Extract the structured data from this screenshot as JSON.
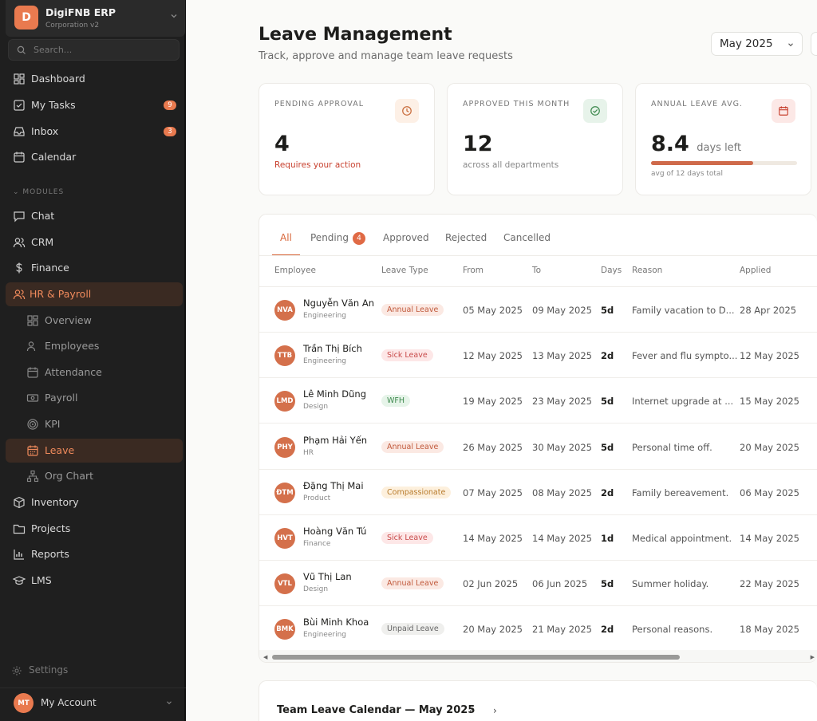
{
  "brand": {
    "initial": "D",
    "name": "DigiFNB ERP",
    "sub": "Corporation v2"
  },
  "search": {
    "placeholder": "Search..."
  },
  "nav_top": [
    {
      "label": "Dashboard",
      "icon": "dashboard-icon"
    },
    {
      "label": "My Tasks",
      "icon": "tasks-icon",
      "badge": "9"
    },
    {
      "label": "Inbox",
      "icon": "inbox-icon",
      "badge": "3"
    },
    {
      "label": "Calendar",
      "icon": "calendar-icon"
    }
  ],
  "modules_label": "MODULES",
  "nav_modules": [
    {
      "label": "Chat"
    },
    {
      "label": "CRM"
    },
    {
      "label": "Finance"
    },
    {
      "label": "HR & Payroll"
    }
  ],
  "nav_hr_sub": [
    {
      "label": "Overview"
    },
    {
      "label": "Employees"
    },
    {
      "label": "Attendance"
    },
    {
      "label": "Payroll"
    },
    {
      "label": "KPI"
    },
    {
      "label": "Leave"
    },
    {
      "label": "Org Chart"
    }
  ],
  "nav_bottom": [
    {
      "label": "Inventory"
    },
    {
      "label": "Projects"
    },
    {
      "label": "Reports"
    },
    {
      "label": "LMS"
    }
  ],
  "settings_label": "Settings",
  "account": {
    "initials": "MT",
    "label": "My Account"
  },
  "header": {
    "title": "Leave Management",
    "subtitle": "Track, approve and manage team leave requests",
    "month": "May 2025"
  },
  "cards": [
    {
      "label": "PENDING APPROVAL",
      "value": "4",
      "note": "Requires your action"
    },
    {
      "label": "APPROVED THIS MONTH",
      "value": "12",
      "note": "across all departments"
    },
    {
      "label": "ANNUAL LEAVE AVG.",
      "value": "8.4",
      "unit": "days left",
      "note": "avg of 12 days total",
      "progress": 0.7
    }
  ],
  "tabs": [
    {
      "label": "All"
    },
    {
      "label": "Pending",
      "count": "4"
    },
    {
      "label": "Approved"
    },
    {
      "label": "Rejected"
    },
    {
      "label": "Cancelled"
    }
  ],
  "table": {
    "headers": [
      "Employee",
      "Leave Type",
      "From",
      "To",
      "Days",
      "Reason",
      "Applied"
    ],
    "rows": [
      {
        "initials": "NVA",
        "name": "Nguyễn Văn An",
        "dept": "Engineering",
        "type": "Annual Leave",
        "from": "05 May 2025",
        "to": "09 May 2025",
        "days": "5d",
        "reason": "Family vacation to D...",
        "applied": "28 Apr 2025"
      },
      {
        "initials": "TTB",
        "name": "Trần Thị Bích",
        "dept": "Engineering",
        "type": "Sick Leave",
        "from": "12 May 2025",
        "to": "13 May 2025",
        "days": "2d",
        "reason": "Fever and flu sympto...",
        "applied": "12 May 2025"
      },
      {
        "initials": "LMD",
        "name": "Lê Minh Dũng",
        "dept": "Design",
        "type": "WFH",
        "from": "19 May 2025",
        "to": "23 May 2025",
        "days": "5d",
        "reason": "Internet upgrade at ...",
        "applied": "15 May 2025"
      },
      {
        "initials": "PHY",
        "name": "Phạm Hải Yến",
        "dept": "HR",
        "type": "Annual Leave",
        "from": "26 May 2025",
        "to": "30 May 2025",
        "days": "5d",
        "reason": "Personal time off.",
        "applied": "20 May 2025"
      },
      {
        "initials": "ĐTM",
        "name": "Đặng Thị Mai",
        "dept": "Product",
        "type": "Compassionate",
        "from": "07 May 2025",
        "to": "08 May 2025",
        "days": "2d",
        "reason": "Family bereavement.",
        "applied": "06 May 2025"
      },
      {
        "initials": "HVT",
        "name": "Hoàng Văn Tú",
        "dept": "Finance",
        "type": "Sick Leave",
        "from": "14 May 2025",
        "to": "14 May 2025",
        "days": "1d",
        "reason": "Medical appointment.",
        "applied": "14 May 2025"
      },
      {
        "initials": "VTL",
        "name": "Vũ Thị Lan",
        "dept": "Design",
        "type": "Annual Leave",
        "from": "02 Jun 2025",
        "to": "06 Jun 2025",
        "days": "5d",
        "reason": "Summer holiday.",
        "applied": "22 May 2025"
      },
      {
        "initials": "BMK",
        "name": "Bùi Minh Khoa",
        "dept": "Engineering",
        "type": "Unpaid Leave",
        "from": "20 May 2025",
        "to": "21 May 2025",
        "days": "2d",
        "reason": "Personal reasons.",
        "applied": "18 May 2025"
      }
    ]
  },
  "calendar": {
    "title": "Team Leave Calendar — May 2025"
  },
  "colors": {
    "accent": "#e97a4f",
    "sidebar": "#1f1f1f"
  }
}
